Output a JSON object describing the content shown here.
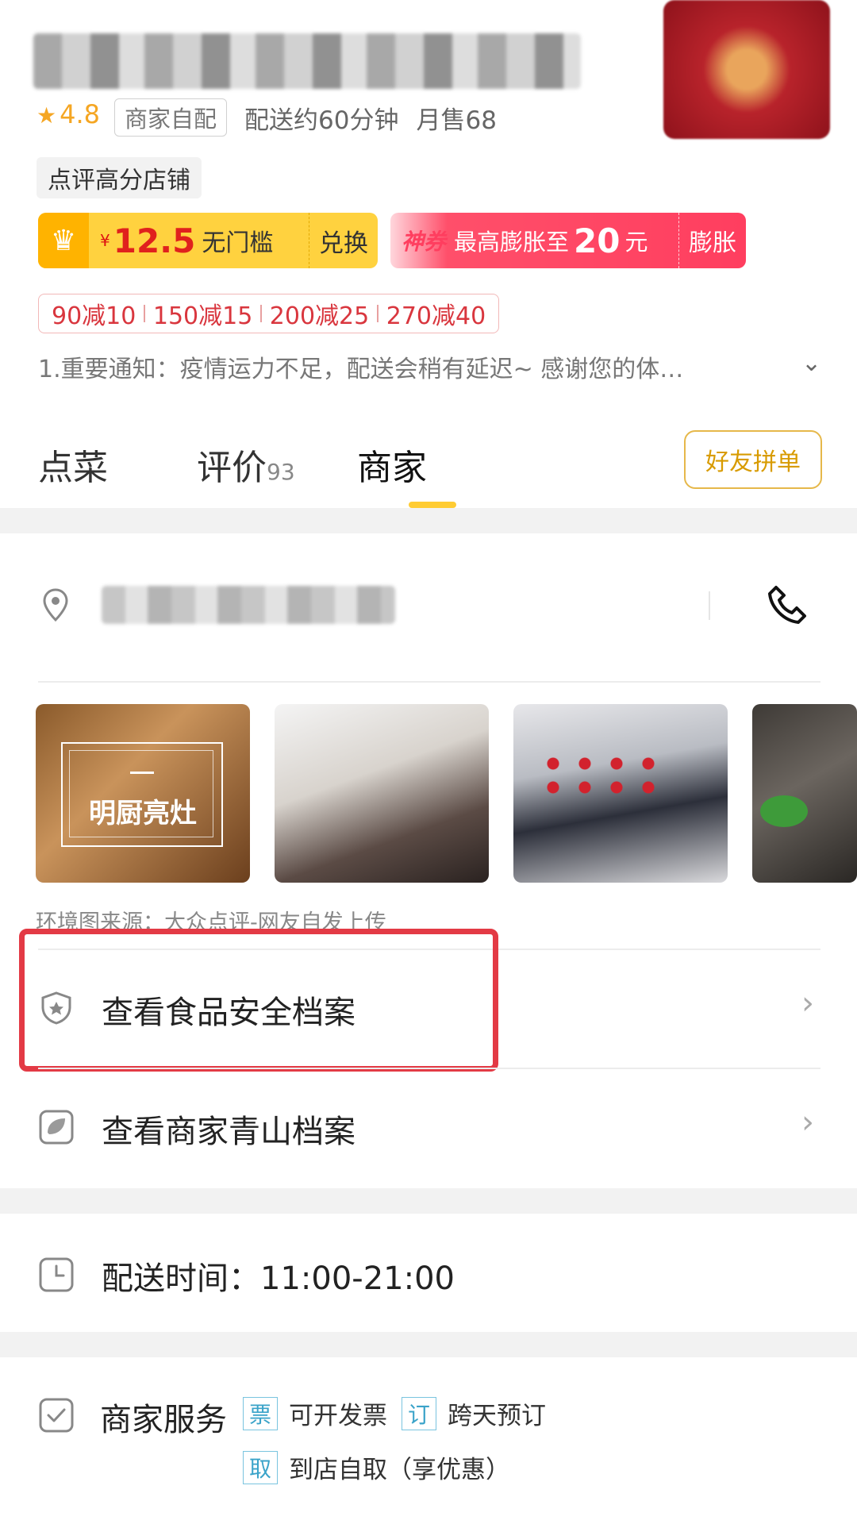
{
  "store": {
    "rating": "4.8",
    "delivery_type": "商家自配",
    "delivery_time": "配送约60分钟",
    "monthly_sales": "月售68",
    "badge": "点评高分店铺"
  },
  "coupon_exchange": {
    "currency": "¥",
    "amount": "12.5",
    "condition": "无门槛",
    "action": "兑换"
  },
  "coupon_boost": {
    "tag": "神券",
    "prefix": "最高膨胀至",
    "amount": "20",
    "unit": "元",
    "action": "膨胀"
  },
  "discounts": [
    "90减10",
    "150减15",
    "200减25",
    "270减40"
  ],
  "notice": "1.重要通知：疫情运力不足，配送会稍有延迟~ 感谢您的体…",
  "tabs": [
    {
      "label": "点菜"
    },
    {
      "label": "评价",
      "count": "93"
    },
    {
      "label": "商家"
    }
  ],
  "friend_order_label": "好友拼单",
  "photos": {
    "first_overlay": "明厨亮灶",
    "source_note": "环境图来源：大众点评-网友自发上传"
  },
  "links": {
    "food_safety": "查看食品安全档案",
    "green_archive": "查看商家青山档案"
  },
  "delivery_hours": "配送时间：11:00-21:00",
  "services": {
    "title": "商家服务",
    "items": [
      {
        "tag": "票",
        "text": "可开发票"
      },
      {
        "tag": "订",
        "text": "跨天预订"
      },
      {
        "tag": "取",
        "text": "到店自取（享优惠）"
      }
    ]
  },
  "colors": {
    "accent_yellow": "#ffcc33",
    "coupon_red": "#ff3e5f",
    "highlight_red": "#e33a45"
  }
}
